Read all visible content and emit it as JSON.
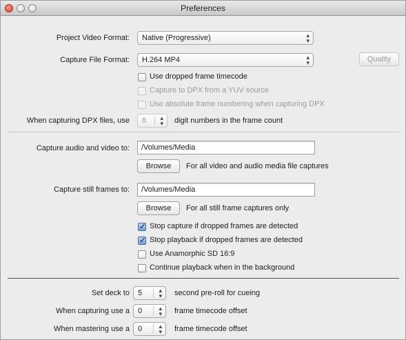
{
  "window": {
    "title": "Preferences"
  },
  "video": {
    "project_format_label": "Project Video Format:",
    "project_format_value": "Native (Progressive)",
    "capture_format_label": "Capture File Format:",
    "capture_format_value": "H.264 MP4",
    "quality_button": "Quality",
    "checkboxes": [
      {
        "label": "Use dropped frame timecode",
        "checked": false,
        "enabled": true
      },
      {
        "label": "Capture to DPX from a YUV source",
        "checked": false,
        "enabled": false
      },
      {
        "label": "Use absolute frame numbering when capturing DPX",
        "checked": false,
        "enabled": false
      }
    ],
    "dpx_label": "When capturing DPX files, use",
    "dpx_digits": "8",
    "dpx_suffix": "digit numbers in the frame count"
  },
  "capture": {
    "av_label": "Capture audio and video to:",
    "av_path": "/Volumes/Media",
    "av_browse": "Browse",
    "av_desc": "For all video and audio media file captures",
    "still_label": "Capture still frames to:",
    "still_path": "/Volumes/Media",
    "still_browse": "Browse",
    "still_desc": "For all still frame captures only",
    "options": [
      {
        "label": "Stop capture if dropped frames are detected",
        "checked": true
      },
      {
        "label": "Stop playback if dropped frames are detected",
        "checked": true
      },
      {
        "label": "Use Anamorphic SD 16:9",
        "checked": false
      },
      {
        "label": "Continue playback when in the background",
        "checked": false
      }
    ]
  },
  "deck": {
    "preroll_label": "Set deck to",
    "preroll_value": "5",
    "preroll_suffix": "second pre-roll for cueing",
    "capture_offset_label": "When capturing use a",
    "capture_offset_value": "0",
    "capture_offset_suffix": "frame timecode offset",
    "master_offset_label": "When mastering use a",
    "master_offset_value": "0",
    "master_offset_suffix": "frame timecode offset"
  }
}
